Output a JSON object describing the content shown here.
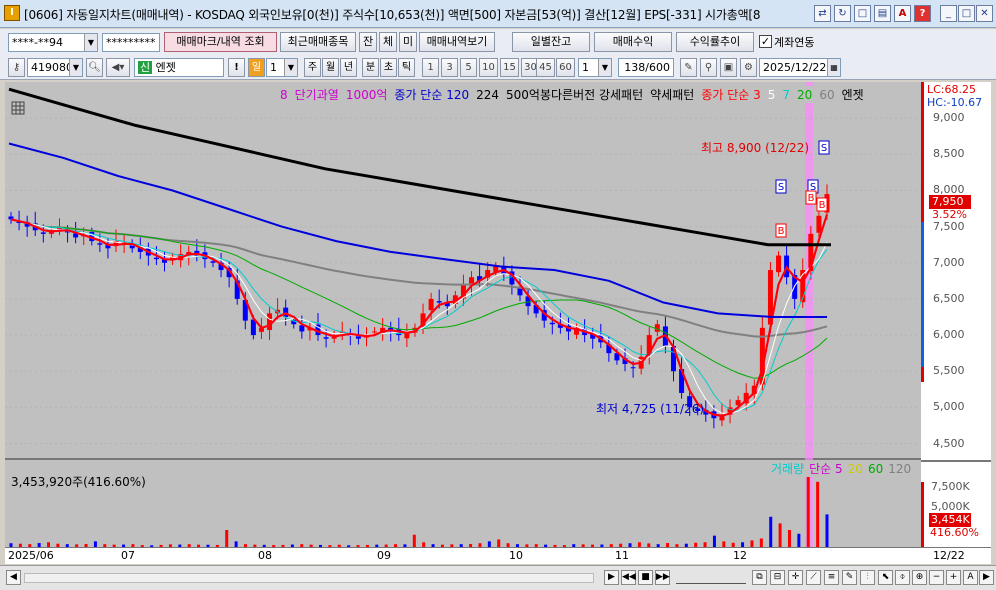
{
  "titlebar": {
    "title": "[0606] 자동일지차트(매매내역) - KOSDAQ 외국인보유[0(천)] 주식수[10,653(천)] 액면[500] 자본금[53(억)] 결산[12월] EPS[-331] 시가총액[8",
    "app_icon": "I"
  },
  "toolbar1": {
    "account": "****-**94",
    "password": "*********",
    "trade_mark_button": "매매마크/내역 조회",
    "recent_trades_button": "최근매매종목",
    "jan_button": "잔",
    "che_button": "체",
    "mi_button": "미",
    "view_trades_button": "매매내역보기",
    "daily_balance_button": "일별잔고",
    "trade_profit_button": "매매수익",
    "return_trend_button": "수익률추이",
    "account_linked_label": "계좌연동",
    "account_linked_checked": true
  },
  "toolbar2": {
    "stock_code": "419080",
    "new_badge": "신",
    "stock_name": "엔젯",
    "period_selected": "일",
    "period_count": "1",
    "periods": [
      "주",
      "월",
      "년",
      "분",
      "초",
      "틱"
    ],
    "intervals": [
      "1",
      "3",
      "5",
      "10",
      "15",
      "30",
      "45",
      "60"
    ],
    "tick_value": "1",
    "bar_count": "138/600",
    "end_date": "2025/12/22"
  },
  "legend_main": [
    {
      "text": "8",
      "color": "#cc00cc"
    },
    {
      "text": "단기과열",
      "color": "#cc00cc"
    },
    {
      "text": "1000억",
      "color": "#cc00cc"
    },
    {
      "text": "종가 단순 120",
      "color": "#0000cc"
    },
    {
      "text": "224",
      "color": "#000000"
    },
    {
      "text": "500억봉다른버전 강세패턴",
      "color": "#000000"
    },
    {
      "text": "약세패턴",
      "color": "#000000"
    },
    {
      "text": "종가 단순 3",
      "color": "#ff0000"
    },
    {
      "text": "5",
      "color": "#ffffff"
    },
    {
      "text": "7",
      "color": "#00cccc"
    },
    {
      "text": "20",
      "color": "#00aa00"
    },
    {
      "text": "60",
      "color": "#808080"
    },
    {
      "text": "엔젯",
      "color": "#000000"
    }
  ],
  "price_axis": {
    "ticks": [
      "9,000",
      "8,500",
      "8,000",
      "7,500",
      "7,000",
      "6,500",
      "6,000",
      "5,500",
      "5,000",
      "4,500"
    ],
    "lc": "LC:68.25",
    "hc": "HC:-10.67",
    "current_price": "7,950",
    "current_change": "3.52%"
  },
  "volume_axis": {
    "ticks": [
      "7,500K",
      "5,000K"
    ],
    "current_volume": "3,454K",
    "current_ratio": "416.60%"
  },
  "volume_info": "3,453,920주(416.60%)",
  "legend_volume": [
    {
      "text": "거래량",
      "color": "#00cccc"
    },
    {
      "text": "단순 5",
      "color": "#cc00cc"
    },
    {
      "text": "20",
      "color": "#cccc00"
    },
    {
      "text": "60",
      "color": "#00aa00"
    },
    {
      "text": "120",
      "color": "#808080"
    }
  ],
  "annotations": {
    "high": "최고 8,900 (12/22)",
    "low": "최저 4,725 (11/26)"
  },
  "signal_markers": [
    "S",
    "S",
    "S",
    "B",
    "B",
    "B"
  ],
  "x_axis": {
    "labels": [
      "2025/06",
      "07",
      "08",
      "09",
      "10",
      "11",
      "12"
    ],
    "right_label": "12/22"
  },
  "chart_data": {
    "type": "candlestick",
    "price_range": [
      4300,
      9500
    ],
    "volume_range_k": [
      0,
      9000
    ],
    "close": [
      7600,
      7550,
      7500,
      7450,
      7400,
      7450,
      7480,
      7420,
      7350,
      7380,
      7300,
      7250,
      7200,
      7300,
      7280,
      7200,
      7150,
      7100,
      7050,
      7000,
      7080,
      7120,
      7150,
      7100,
      7050,
      7000,
      6900,
      6800,
      6500,
      6200,
      6000,
      6100,
      6300,
      6350,
      6250,
      6150,
      6050,
      6100,
      6000,
      5950,
      6000,
      6050,
      6000,
      5950,
      6000,
      6050,
      6100,
      6050,
      6000,
      6050,
      6100,
      6300,
      6500,
      6450,
      6400,
      6550,
      6700,
      6800,
      6750,
      6900,
      6950,
      6850,
      6700,
      6550,
      6400,
      6300,
      6200,
      6150,
      6100,
      6050,
      6100,
      6000,
      5950,
      5900,
      5750,
      5650,
      5600,
      5550,
      5700,
      6000,
      6150,
      5850,
      5500,
      5200,
      5000,
      4950,
      4900,
      4850,
      4900,
      5000,
      5100,
      5200,
      5300,
      6100,
      6900,
      7100,
      6800,
      6500,
      6900,
      7400,
      7650,
      7950
    ],
    "ma120": [
      8650,
      8450,
      8200,
      8000,
      7750,
      7500,
      7300,
      7150,
      7050,
      6950,
      6900,
      6750,
      6450,
      6300,
      6250,
      6250
    ],
    "ma224": [
      9400,
      9150,
      8900,
      8700,
      8500,
      8300,
      8150,
      8000,
      7850,
      7700,
      7550,
      7400,
      7250,
      7250
    ],
    "volume_k": [
      400,
      350,
      300,
      420,
      500,
      350,
      300,
      280,
      320,
      600,
      300,
      250,
      260,
      300,
      200,
      180,
      220,
      280,
      260,
      300,
      250,
      240,
      220,
      1800,
      600,
      300,
      250,
      230,
      200,
      220,
      260,
      300,
      250,
      220,
      200,
      240,
      180,
      200,
      220,
      250,
      260,
      300,
      280,
      1300,
      500,
      300,
      250,
      280,
      300,
      320,
      400,
      600,
      800,
      400,
      300,
      280,
      300,
      250,
      220,
      200,
      300,
      280,
      250,
      260,
      300,
      350,
      400,
      500,
      380,
      300,
      420,
      300,
      350,
      450,
      500,
      1200,
      600,
      450,
      500,
      700,
      900,
      3200,
      2500,
      1800,
      1400,
      9100,
      6900,
      3454
    ]
  }
}
